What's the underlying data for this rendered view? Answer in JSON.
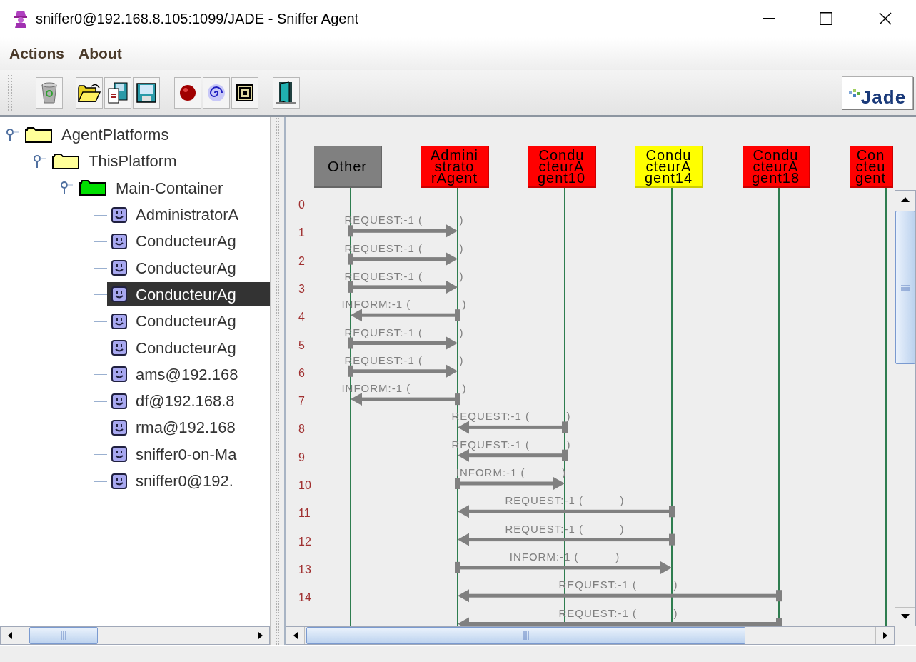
{
  "window": {
    "title": "sniffer0@192.168.8.105:1099/JADE - Sniffer Agent"
  },
  "menu": [
    {
      "label": "Actions"
    },
    {
      "label": "About"
    }
  ],
  "logo": {
    "text": "Jade"
  },
  "tree": [
    {
      "label": "AgentPlatforms",
      "kind": "folder",
      "expanded": true,
      "selected": false,
      "children": [
        {
          "label": "ThisPlatform",
          "kind": "folder",
          "expanded": true,
          "selected": false,
          "children": [
            {
              "label": "Main-Container",
              "kind": "container",
              "expanded": true,
              "selected": false,
              "children": [
                {
                  "label": "AdministratorA",
                  "kind": "agent",
                  "selected": false
                },
                {
                  "label": "ConducteurAg",
                  "kind": "agent",
                  "selected": false
                },
                {
                  "label": "ConducteurAg",
                  "kind": "agent",
                  "selected": false
                },
                {
                  "label": "ConducteurAg",
                  "kind": "agent",
                  "selected": true
                },
                {
                  "label": "ConducteurAg",
                  "kind": "agent",
                  "selected": false
                },
                {
                  "label": "ConducteurAg",
                  "kind": "agent",
                  "selected": false
                },
                {
                  "label": "ams@192.168",
                  "kind": "agent",
                  "selected": false
                },
                {
                  "label": "df@192.168.8",
                  "kind": "agent",
                  "selected": false
                },
                {
                  "label": "rma@192.168",
                  "kind": "agent",
                  "selected": false
                },
                {
                  "label": "sniffer0-on-Ma",
                  "kind": "agent",
                  "selected": false
                },
                {
                  "label": "sniffer0@192.",
                  "kind": "agent",
                  "selected": false
                }
              ]
            }
          ]
        }
      ]
    }
  ],
  "agents": [
    {
      "lines": [
        "Other"
      ],
      "color": "#808080"
    },
    {
      "lines": [
        "Admini",
        "strato",
        "rAgent"
      ],
      "color": "#ff0000"
    },
    {
      "lines": [
        "Condu",
        "cteurA",
        "gent10"
      ],
      "color": "#ff0000"
    },
    {
      "lines": [
        "Condu",
        "cteurA",
        "gent14"
      ],
      "color": "#ffff00"
    },
    {
      "lines": [
        "Condu",
        "cteurA",
        "gent18"
      ],
      "color": "#ff0000"
    },
    {
      "lines": [
        "Con",
        "cteu",
        "gent"
      ],
      "color": "#ff0000"
    }
  ],
  "rows": [
    "0",
    "1",
    "2",
    "3",
    "4",
    "5",
    "6",
    "7",
    "8",
    "9",
    "10",
    "11",
    "12",
    "13",
    "14"
  ],
  "messages": [
    {
      "label": "REQUEST:-1 (          )",
      "kind": "other_admin"
    },
    {
      "label": "REQUEST:-1 (          )",
      "kind": "other_admin"
    },
    {
      "label": "REQUEST:-1 (          )",
      "kind": "other_admin"
    },
    {
      "label": "INFORM:-1 (              )",
      "kind": "admin_other"
    },
    {
      "label": "REQUEST:-1 (          )",
      "kind": "other_admin"
    },
    {
      "label": "REQUEST:-1 (          )",
      "kind": "other_admin"
    },
    {
      "label": "INFORM:-1 (              )",
      "kind": "admin_other"
    },
    {
      "label": "REQUEST:-1 (          )",
      "kind": "c10_admin"
    },
    {
      "label": "REQUEST:-1 (          )",
      "kind": "c10_admin"
    },
    {
      "label": "INFORM:-1 (          )",
      "kind": "admin_c10"
    },
    {
      "label": "REQUEST:-1 (          )",
      "kind": "c14_admin"
    },
    {
      "label": "REQUEST:-1 (          )",
      "kind": "c14_admin"
    },
    {
      "label": "INFORM:-1 (          )",
      "kind": "admin_c14"
    },
    {
      "label": "REQUEST:-1 (          )",
      "kind": "c18_admin"
    },
    {
      "label": "REQUEST:-1 (          )",
      "kind": "c18_admin"
    }
  ]
}
